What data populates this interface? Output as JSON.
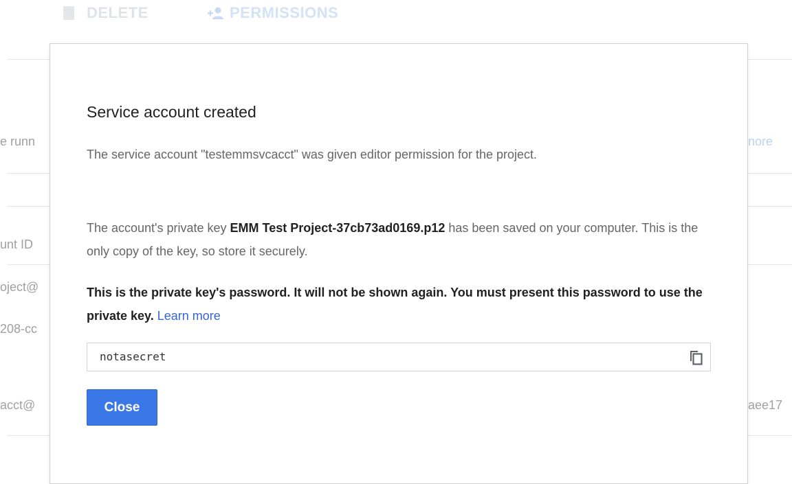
{
  "background": {
    "toolbar": {
      "delete_label": "DELETE",
      "permissions_label": "PERMISSIONS"
    },
    "fragments": {
      "left_1": "e runn",
      "right_1": "nore",
      "left_2": "unt ID",
      "left_3": "oject@",
      "left_4": "208-cc",
      "left_5": "acct@",
      "right_5": "aee17"
    }
  },
  "dialog": {
    "title": "Service account created",
    "paragraph1": "The service account \"testemmsvcacct\" was given editor permission for the project.",
    "paragraph2_before": "The account's private key ",
    "paragraph2_key": "EMM Test Project-37cb73ad0169.p12",
    "paragraph2_after": " has been saved on your computer. This is the only copy of the key, so store it securely.",
    "paragraph3": "This is the private key's password. It will not be shown again. You must present this password to use the private key.",
    "learn_more": "Learn more",
    "password_value": "notasecret",
    "close_label": "Close"
  },
  "colors": {
    "primary_button": "#3b78e7",
    "link": "#3367d6",
    "body_text": "#666666",
    "strong_text": "#212121"
  },
  "icons": {
    "copy": "copy-icon",
    "delete": "trash-icon",
    "permissions": "add-person-icon"
  }
}
